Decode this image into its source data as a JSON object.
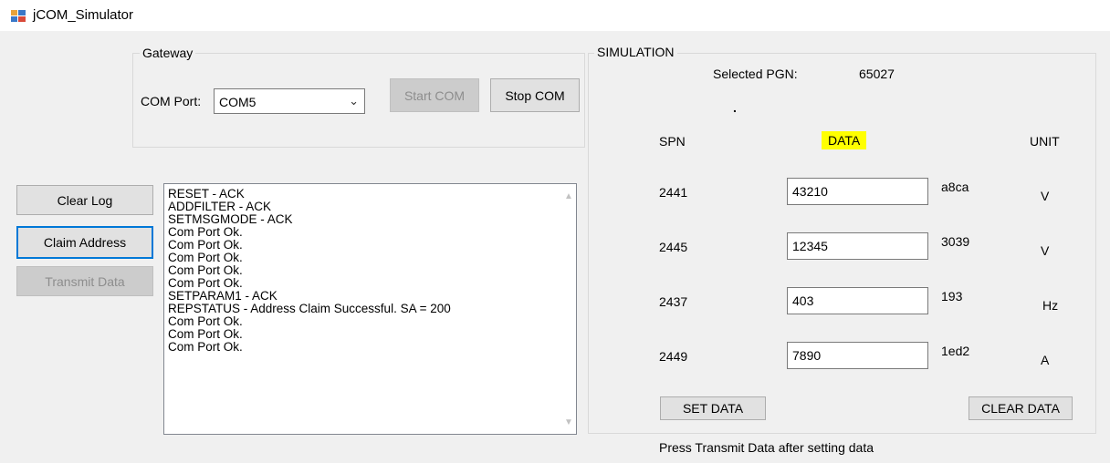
{
  "window": {
    "title": "jCOM_Simulator"
  },
  "gateway": {
    "legend": "Gateway",
    "com_port_label": "COM Port:",
    "com_port_value": "COM5",
    "start_com_label": "Start COM",
    "stop_com_label": "Stop COM"
  },
  "actions": {
    "clear_log_label": "Clear Log",
    "claim_address_label": "Claim Address",
    "transmit_data_label": "Transmit Data"
  },
  "log": {
    "lines": [
      "RESET - ACK",
      "ADDFILTER - ACK",
      "SETMSGMODE - ACK",
      "Com Port Ok.",
      "Com Port Ok.",
      "Com Port Ok.",
      "Com Port Ok.",
      "Com Port Ok.",
      "SETPARAM1 - ACK",
      "REPSTATUS - Address Claim Successful. SA = 200",
      "Com Port Ok.",
      "Com Port Ok.",
      "Com Port Ok."
    ]
  },
  "simulation": {
    "legend": "SIMULATION",
    "selected_pgn_label": "Selected PGN:",
    "selected_pgn_value": "65027",
    "dot": ".",
    "headers": {
      "spn": "SPN",
      "data": "DATA",
      "unit": "UNIT"
    },
    "rows": [
      {
        "spn": "2441",
        "data": "43210",
        "hex": "a8ca",
        "unit": "V"
      },
      {
        "spn": "2445",
        "data": "12345",
        "hex": "3039",
        "unit": "V"
      },
      {
        "spn": "2437",
        "data": "403",
        "hex": "193",
        "unit": "Hz"
      },
      {
        "spn": "2449",
        "data": "7890",
        "hex": "1ed2",
        "unit": "A"
      }
    ],
    "set_data_label": "SET DATA",
    "clear_data_label": "CLEAR DATA",
    "hint": "Press Transmit Data after setting data"
  },
  "colors": {
    "highlight": "#ffff00",
    "focus": "#0078d7"
  }
}
